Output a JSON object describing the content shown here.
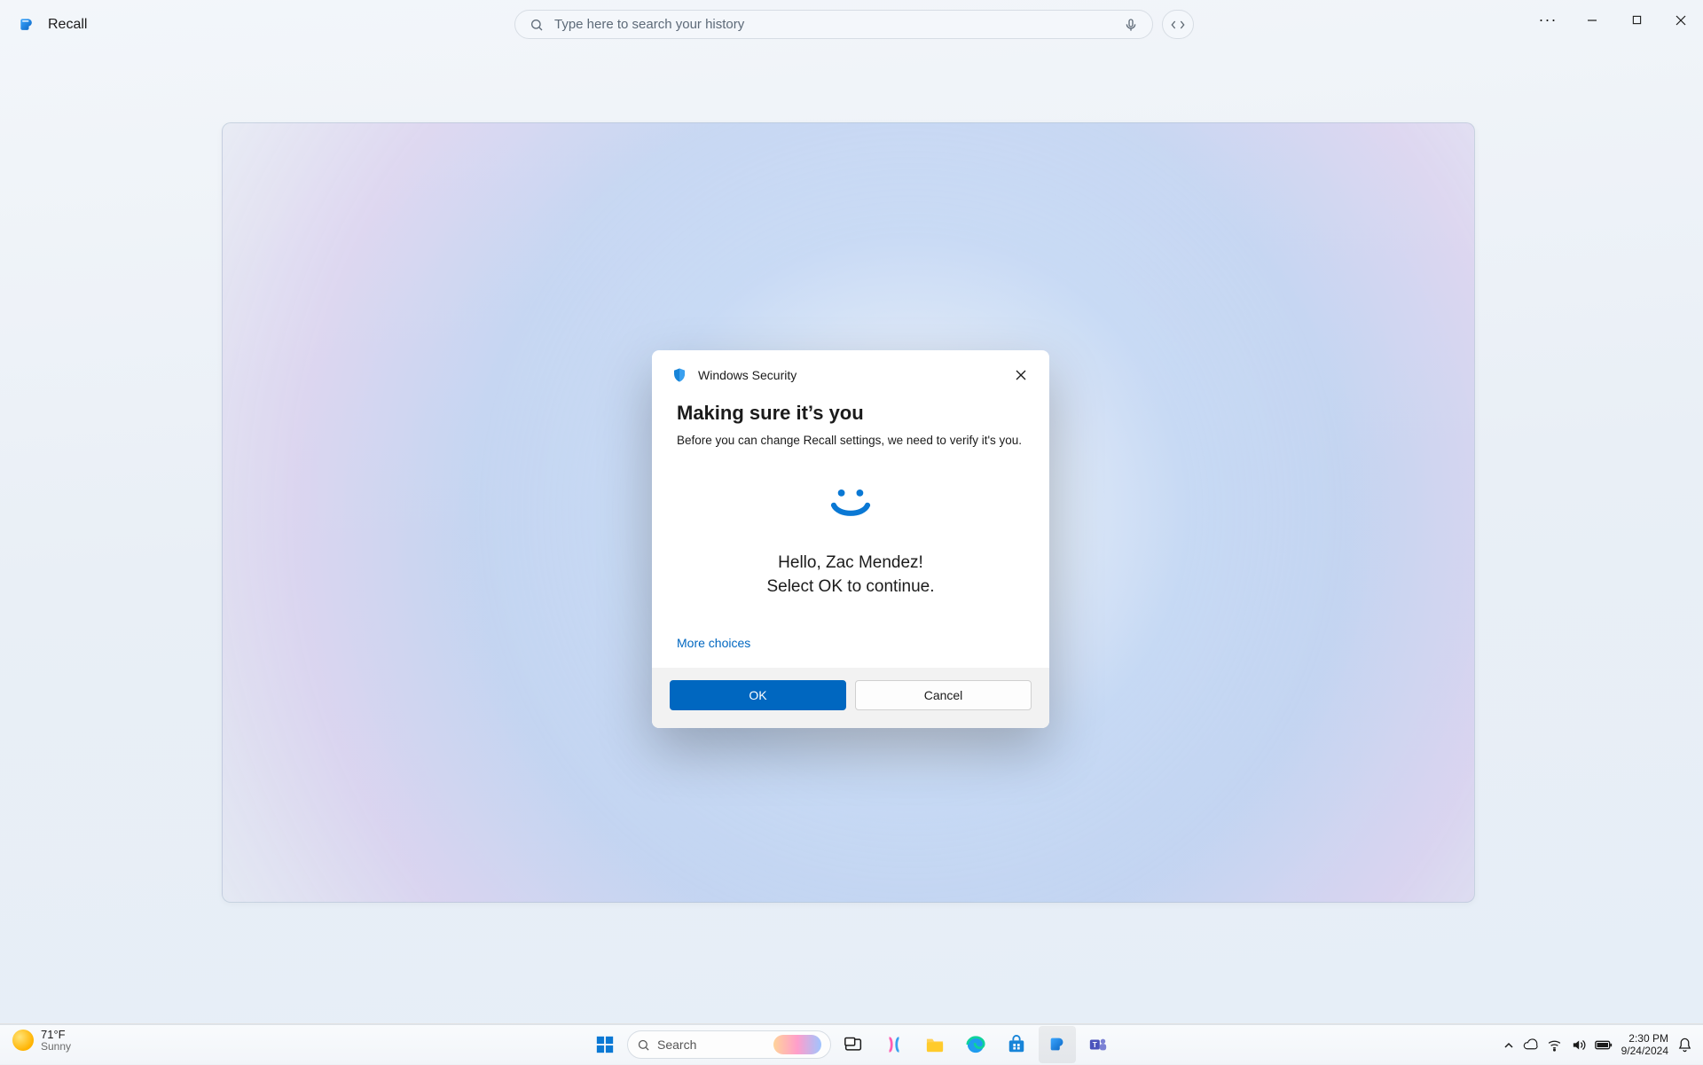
{
  "app": {
    "title": "Recall"
  },
  "search": {
    "placeholder": "Type here to search your history"
  },
  "security_dialog": {
    "window_title": "Windows Security",
    "heading": "Making sure it’s you",
    "subtitle": "Before you can change Recall settings, we need to verify it's you.",
    "hello_line1": "Hello, Zac Mendez!",
    "hello_line2": "Select OK to continue.",
    "more_choices": "More choices",
    "ok_label": "OK",
    "cancel_label": "Cancel"
  },
  "taskbar": {
    "weather": {
      "temp": "71°F",
      "condition": "Sunny"
    },
    "search_placeholder": "Search",
    "time": "2:30 PM",
    "date": "9/24/2024"
  },
  "colors": {
    "accent": "#0067c0"
  }
}
